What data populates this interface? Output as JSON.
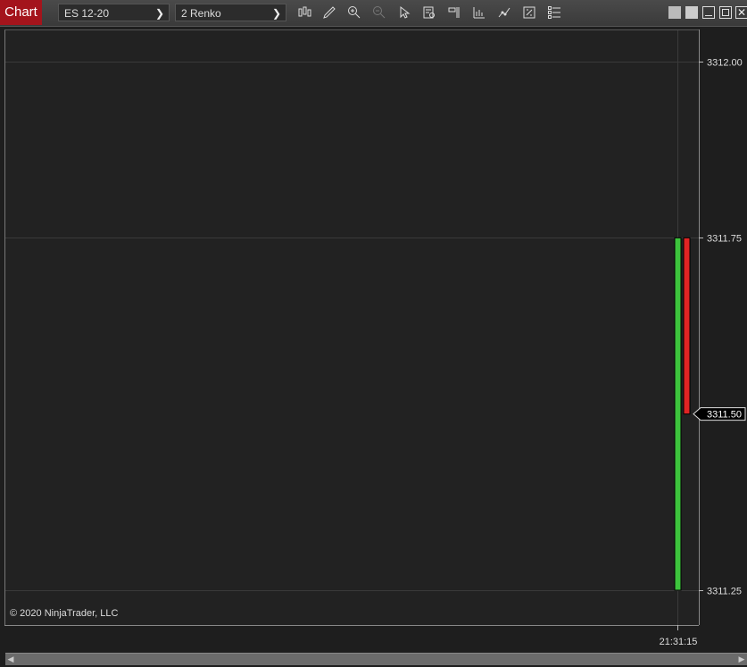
{
  "toolbar": {
    "chart_tab": "Chart",
    "instrument": "ES 12-20",
    "bar_type": "2 Renko",
    "icons": [
      "bars-type-icon",
      "pencil-draw-icon",
      "zoom-in-icon",
      "zoom-out-icon",
      "pointer-icon",
      "data-box-icon",
      "strategies-icon",
      "indicators-icon",
      "chart-trader-icon",
      "properties-icon",
      "templates-icon"
    ]
  },
  "window": {
    "buttons": [
      "tile-icon",
      "tile-icon-2",
      "minimize-icon",
      "maximize-icon",
      "close-icon"
    ]
  },
  "chart_data": {
    "type": "renko",
    "price_ticks": [
      "3312.00",
      "3311.75",
      "3311.50",
      "3311.25"
    ],
    "last_price": "3311.50",
    "time_label": "21:31:15",
    "bricks": [
      {
        "open": 3311.25,
        "close": 3311.75,
        "color": "#3dc43d",
        "direction": "up"
      },
      {
        "open": 3311.75,
        "close": 3311.5,
        "color": "#e02424",
        "direction": "down"
      }
    ],
    "ylim": [
      3311.2,
      3312.05
    ],
    "grid": true
  },
  "copyright": "© 2020 NinjaTrader, LLC",
  "colors": {
    "up": "#3dc43d",
    "down": "#e02424",
    "accent": "#a4141c",
    "background": "#222222"
  }
}
